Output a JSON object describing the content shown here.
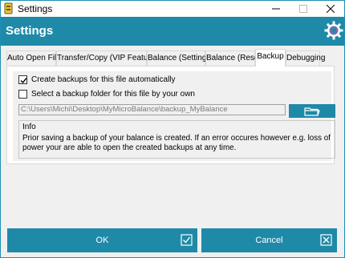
{
  "window": {
    "title": "Settings"
  },
  "header": {
    "title": "Settings"
  },
  "tabs": [
    {
      "label": "Auto Open File"
    },
    {
      "label": "Transfer/Copy (VIP Feature)"
    },
    {
      "label": "Balance (Settings)"
    },
    {
      "label": "Balance (Reset)"
    },
    {
      "label": "Backup",
      "active": true
    },
    {
      "label": "Debugging"
    }
  ],
  "backup": {
    "create_backups_label": "Create backups for this file automatically",
    "create_backups_checked": true,
    "select_folder_label": "Select a backup folder for this file by your own",
    "select_folder_checked": false,
    "folder_path": "C:\\Users\\Michi\\Desktop\\MyMicroBalance\\backup_MyBalance",
    "info_title": "Info",
    "info_text": "Prior saving a backup of your balance is created. If an error occures however e.g. loss of power your are able to open the created backups at any time."
  },
  "buttons": {
    "ok_label": "OK",
    "cancel_label": "Cancel"
  },
  "colors": {
    "accent": "#1f89a8",
    "title_bar": "#ffffff",
    "background": "#f0f0f0"
  }
}
